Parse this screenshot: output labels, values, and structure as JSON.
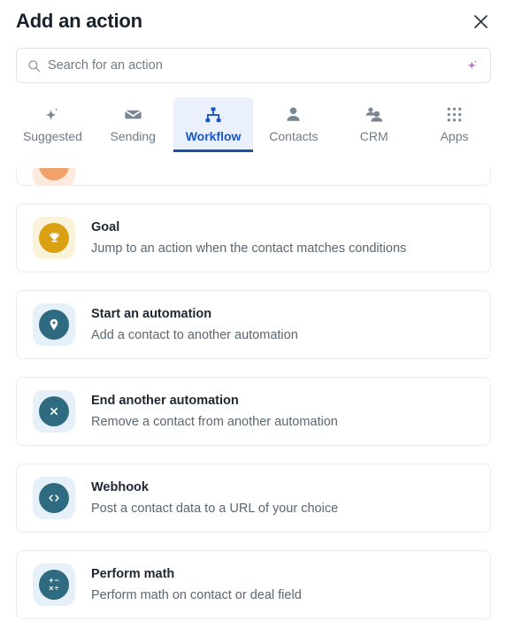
{
  "header": {
    "title": "Add an action",
    "close_label": "×",
    "close_icon": "close-icon"
  },
  "search": {
    "placeholder": "Search for an action",
    "value": "",
    "icon": "search-icon",
    "ai_icon": "sparkle-icon"
  },
  "tabs": [
    {
      "label": "Suggested",
      "icon": "sparkle-icon",
      "active": false
    },
    {
      "label": "Sending",
      "icon": "envelope-icon",
      "active": false
    },
    {
      "label": "Workflow",
      "icon": "workflow-hierarchy-icon",
      "active": true
    },
    {
      "label": "Contacts",
      "icon": "person-icon",
      "active": false
    },
    {
      "label": "CRM",
      "icon": "people-icon",
      "active": false
    },
    {
      "label": "Apps",
      "icon": "grid-dots-icon",
      "active": false
    }
  ],
  "actions": [
    {
      "title": "",
      "desc": "",
      "icon": "partial-icon",
      "icon_bg": "#fdeadd",
      "icon_fg": "#f0a26a",
      "partial": true
    },
    {
      "title": "Goal",
      "desc": "Jump to an action when the contact matches conditions",
      "icon": "trophy-icon",
      "icon_bg": "#fbf2da",
      "icon_fg": "#d9a112",
      "partial": false
    },
    {
      "title": "Start an automation",
      "desc": "Add a contact to another automation",
      "icon": "map-pin-icon",
      "icon_bg": "#e6f0f8",
      "icon_fg": "#2f6b80",
      "partial": false
    },
    {
      "title": "End another automation",
      "desc": "Remove a contact from another automation",
      "icon": "circle-x-icon",
      "icon_bg": "#e6f0f8",
      "icon_fg": "#2f6b80",
      "partial": false
    },
    {
      "title": "Webhook",
      "desc": "Post a contact data to a URL of your choice",
      "icon": "code-brackets-icon",
      "icon_bg": "#e6f0f8",
      "icon_fg": "#2f6b80",
      "partial": false
    },
    {
      "title": "Perform math",
      "desc": "Perform math on contact or deal field",
      "icon": "math-operators-icon",
      "icon_bg": "#e6f0f8",
      "icon_fg": "#2f6b80",
      "partial": false,
      "math_symbols": [
        "+",
        "−",
        "×",
        "÷"
      ]
    }
  ],
  "colors": {
    "accent_blue": "#1a56c4",
    "tab_active_bg": "#eaf1fd",
    "tab_underline": "#1b4ea8",
    "teal": "#2f6b80",
    "gold": "#d9a112",
    "text_dark": "#1f2733",
    "text_muted": "#5a6672",
    "border": "#ececef"
  }
}
